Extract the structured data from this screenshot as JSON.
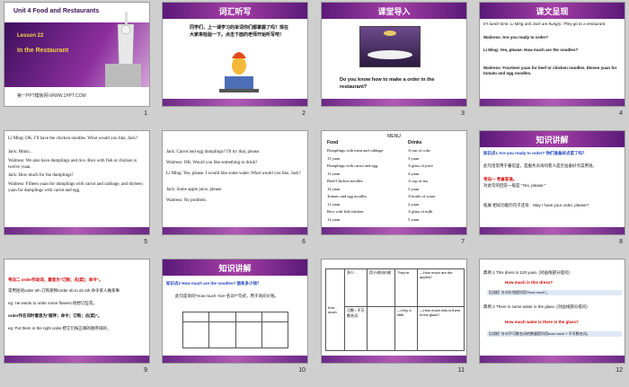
{
  "slides": [
    {
      "num": "1",
      "unit": "Unit 4 Food and Restaurants",
      "lesson": "Lesson 22",
      "title": "In the Restaurant",
      "footer": "第一PPT模板网-WWW.1PPT.COM"
    },
    {
      "num": "2",
      "banner": "词汇听写",
      "text": "同学们，上一课学习的单词你们都掌握了吗？现在大家来检验一下。点击下面的老师开始听写吧！"
    },
    {
      "num": "3",
      "banner": "课堂导入",
      "text": "Do you know how to make a order in the restaurant?"
    },
    {
      "num": "4",
      "banner": "课文呈现",
      "lines": [
        "It's lunch time. Li Ming and Jack are hungry. They go to a restaurant.",
        "Waitress:  Are you ready to order?",
        "Li Ming:  Yes, please. How much are the noodles?",
        "Waitress:  Fourteen yuan for beef or chicken noodles. Eleven yuan for tomato and egg noodles."
      ]
    },
    {
      "num": "5",
      "lines": [
        "Li Ming:  OK. I'll have the chicken noodles. What would you like, Jack?",
        "Jack:  Hmm...",
        "Waitress:  We also have dumplings and rice. Rice with fish or chicken is twelve yuan.",
        "Jack:  How much for the dumplings?",
        "Waitress:  Fifteen yuan for dumplings with carrot and cabbage, and thirteen yuan for dumplings with carrot and egg."
      ]
    },
    {
      "num": "6",
      "lines": [
        "Jack:  Carrot and egg dumplings? I'll try that, please.",
        "Waitress:  OK. Would you like something to drink?",
        "Li Ming:  Yes, please. I would like some water. What would you like, Jack?",
        "Jack:  Some apple juice, please.",
        "Waitress:  No problem."
      ]
    },
    {
      "num": "7",
      "menu_title": "MENU",
      "food_head": "Food",
      "drink_head": "Drinks",
      "food": [
        "Dumplings with meat and cabbage",
        "13 yuan",
        "Dumplings with carrot and egg",
        "13 yuan",
        "Beef/Chicken noodles",
        "14 yuan",
        "Tomato and egg noodles",
        "11 yuan",
        "Rice with fish/chicken",
        "12 yuan"
      ],
      "drinks": [
        "A can of coke",
        "3 yuan",
        "A glass of juice",
        "4 yuan",
        "A cup of tea",
        "3 yuan",
        "A bottle of water",
        "2 yuan",
        "A glass of milk",
        "5 yuan"
      ]
    },
    {
      "num": "8",
      "banner": "知识讲解",
      "lines": [
        "知识点1 Are you ready to order? 你们准备好点菜了吗？",
        "此句话常用于餐馆里，是服务员询问客人是否准备好点菜用语。",
        "考向一 考查答语。",
        "对此句的回答一般是 \"Yes, please.\"",
        "拓展 相同功能的句子还有：May I have your order, please?"
      ]
    },
    {
      "num": "9",
      "lines": [
        "考向二 order作动词，意思为\"订购；点(菜)；命令\"。",
        "常用短语order sth.订购某物/order sb.to do sth.命令某人做某事",
        "eg: He wants to order some flowers.他想订些花。",
        "order作名词时意思为\"顺序；命令；订购；点(菜)\"。",
        "eg: Put them in the right order.把它们按正确的顺序排好。"
      ]
    },
    {
      "num": "10",
      "banner": "知识讲解",
      "lines": [
        "知识点2 How much are the noodles? 面条多少钱？",
        "此句是询问\"How much +be+名词?\"句式，用于询问价钱。"
      ]
    },
    {
      "num": "11",
      "lines": [
        "how much",
        "多少...",
        "用于询问价格",
        "—How much are the apples?",
        "可数 / 不可数名词",
        "They're",
        "—How much milk is there in the glass?",
        "—Only a little."
      ]
    },
    {
      "num": "12",
      "lines": [
        "典例 1  This dress is 120 yuan. (对画线部分提问)",
        "How  much  is this dress?",
        "【点拨】针对价钱提问用\"How much\"。",
        "典例 2  There is some water in the glass. (对画线部分提问)",
        "How  much  water  is there in the glass?",
        "【点拨】针对不可数名词的数量提问用how much + 不可数名词。"
      ]
    }
  ]
}
